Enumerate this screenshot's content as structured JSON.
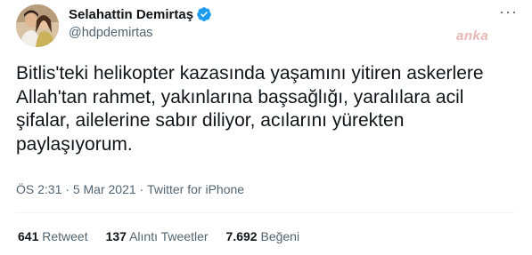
{
  "header": {
    "display_name": "Selahattin Demirtaş",
    "handle": "@hdpdemirtas",
    "more_label": "···",
    "watermark": "anka"
  },
  "tweet": {
    "text_lines": [
      "Bitlis'teki helikopter kazasında yaşamını yitiren askerlere",
      "Allah'tan rahmet, yakınlarına başsağlığı, yaralılara acil",
      "şifalar, ailelerine sabır diliyor, acılarını yürekten",
      "paylaşıyorum."
    ],
    "time": "ÖS 2:31",
    "separator": " · ",
    "date": "5 Mar 2021",
    "source": "Twitter for iPhone"
  },
  "stats": {
    "retweets": {
      "count": "641",
      "label": "Retweet"
    },
    "quotes": {
      "count": "137",
      "label": "Alıntı Tweetler"
    },
    "likes": {
      "count": "7.692",
      "label": "Beğeni"
    }
  },
  "colors": {
    "verified_blue": "#1d9bf0",
    "secondary_text": "#536471",
    "watermark": "#e8b7b4"
  },
  "icons": [
    "avatar-image",
    "verified-badge-icon",
    "more-options-icon"
  ]
}
